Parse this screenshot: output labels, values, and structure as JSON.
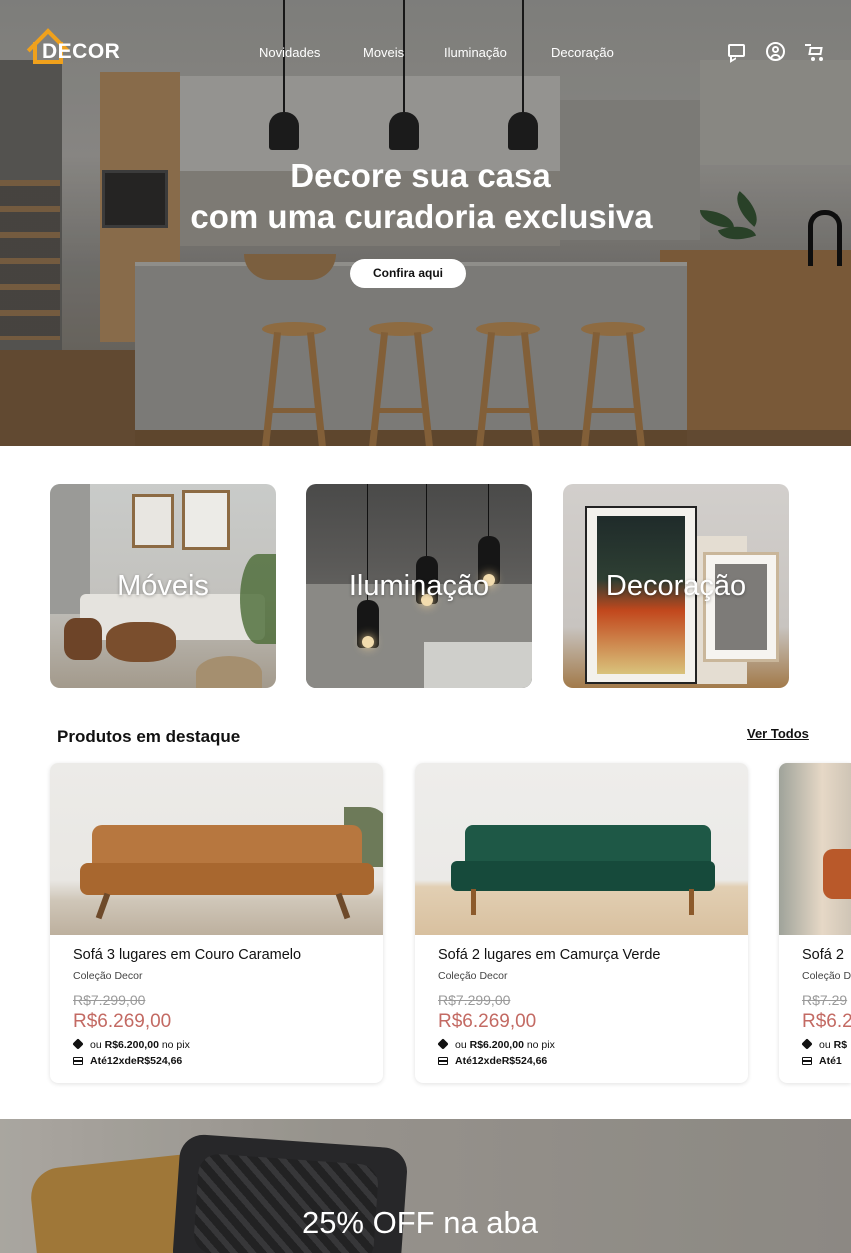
{
  "brand": {
    "logo_text": "DECOR",
    "accent_color": "#f0a11c"
  },
  "nav": {
    "links": [
      "Novidades",
      "Moveis",
      "Iluminação",
      "Decoração"
    ],
    "icons": [
      "chat-icon",
      "user-icon",
      "cart-icon"
    ]
  },
  "hero": {
    "title_line1": "Decore sua casa",
    "title_line2": "com uma curadoria exclusiva",
    "cta_label": "Confira aqui"
  },
  "categories": [
    {
      "label": "Móveis"
    },
    {
      "label": "Iluminação"
    },
    {
      "label": "Decoração"
    }
  ],
  "featured": {
    "title": "Produtos em destaque",
    "see_all_label": "Ver Todos",
    "price_color": "#c36a63",
    "products": [
      {
        "name": "Sofá 3 lugares em Couro Caramelo",
        "collection": "Coleção Decor",
        "old_price": "R$7.299,00",
        "price": "R$6.269,00",
        "pix_prefix": "ou",
        "pix_value": "R$6.200,00",
        "pix_suffix": "no pix",
        "installments_prefix": "Até",
        "installments_count": "12x",
        "installments_mid": "de",
        "installments_value": "R$524,66"
      },
      {
        "name": "Sofá 2 lugares em Camurça Verde",
        "collection": "Coleção Decor",
        "old_price": "R$7.299,00",
        "price": "R$6.269,00",
        "pix_prefix": "ou",
        "pix_value": "R$6.200,00",
        "pix_suffix": "no pix",
        "installments_prefix": "Até",
        "installments_count": "12x",
        "installments_mid": "de",
        "installments_value": "R$524,66"
      },
      {
        "name": "Sofá 2",
        "collection": "Coleção D",
        "old_price": "R$7.29",
        "price": "R$6.2",
        "pix_prefix": "ou",
        "pix_value": "R$",
        "pix_suffix": "",
        "installments_prefix": "Até",
        "installments_count": "1",
        "installments_mid": "",
        "installments_value": ""
      }
    ]
  },
  "banner": {
    "text": "25% OFF na aba"
  }
}
